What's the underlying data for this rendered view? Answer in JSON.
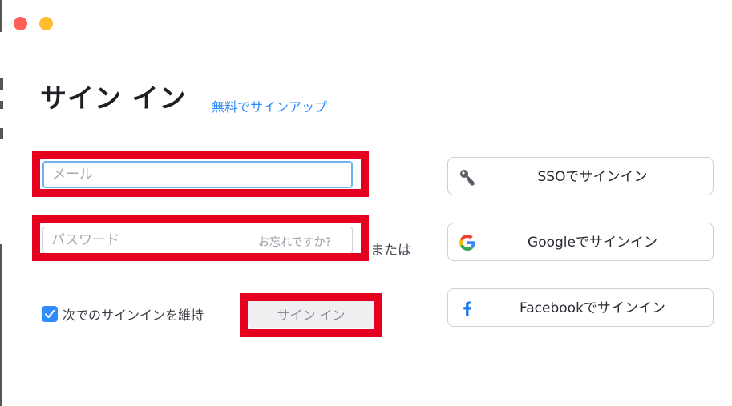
{
  "window": {
    "controls": [
      "close",
      "minimize"
    ]
  },
  "header": {
    "title": "サイン イン",
    "signup_link": "無料でサインアップ"
  },
  "form": {
    "email": {
      "placeholder": "メール",
      "value": ""
    },
    "password": {
      "placeholder": "パスワード",
      "value": "",
      "forgot_link": "お忘れですか?"
    },
    "remember": {
      "label": "次でのサインインを維持",
      "checked": true
    },
    "signin_button": "サイン イン"
  },
  "divider": {
    "or_text": "または"
  },
  "alternatives": {
    "sso": {
      "label": "SSOでサインイン",
      "icon": "key-icon"
    },
    "google": {
      "label": "Googleでサインイン",
      "icon": "google-icon"
    },
    "facebook": {
      "label": "Facebookでサインイン",
      "icon": "facebook-icon"
    }
  },
  "colors": {
    "accent": "#2d8cff",
    "highlight": "#e6001f",
    "facebook": "#1877f2"
  }
}
